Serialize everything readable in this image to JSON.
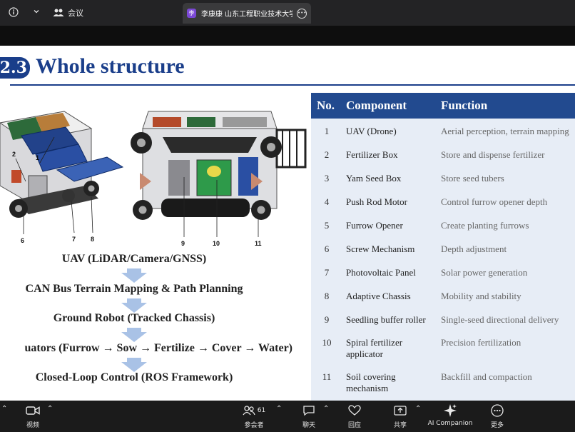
{
  "topbar": {
    "meeting_label": "会议",
    "tab_icon_letter": "李",
    "tab_title": "李康康 山东工程职业技术大学的..."
  },
  "slide": {
    "section_number": "2.3",
    "title": "Whole structure",
    "accent_color": "#1a3e8a",
    "figure_labels": [
      "1",
      "2",
      "6",
      "7",
      "8",
      "9",
      "10",
      "11"
    ],
    "flow": [
      "UAV (LiDAR/Camera/GNSS)",
      "CAN Bus Terrain Mapping & Path Planning",
      "Ground Robot (Tracked Chassis)",
      "uators (Furrow → Sow → Fertilize → Cover → Water)",
      "Closed-Loop Control (ROS Framework)"
    ],
    "table": {
      "headers": {
        "no": "No.",
        "component": "Component",
        "function": "Function"
      },
      "rows": [
        {
          "no": "1",
          "component": "UAV (Drone)",
          "function": "Aerial perception, terrain mapping"
        },
        {
          "no": "2",
          "component": "Fertilizer Box",
          "function": "Store and dispense fertilizer"
        },
        {
          "no": "3",
          "component": "Yam Seed Box",
          "function": "Store seed tubers"
        },
        {
          "no": "4",
          "component": "Push Rod Motor",
          "function": "Control furrow opener depth"
        },
        {
          "no": "5",
          "component": "Furrow Opener",
          "function": "Create planting furrows"
        },
        {
          "no": "6",
          "component": "Screw Mechanism",
          "function": "Depth adjustment"
        },
        {
          "no": "7",
          "component": "Photovoltaic Panel",
          "function": "Solar power generation"
        },
        {
          "no": "8",
          "component": "Adaptive Chassis",
          "function": "Mobility and stability"
        },
        {
          "no": "9",
          "component": "Seedling buffer roller",
          "function": "Single-seed directional delivery"
        },
        {
          "no": "10",
          "component": "Spiral fertilizer applicator",
          "function": "Precision fertilization"
        },
        {
          "no": "11",
          "component": "Soil covering mechanism",
          "function": "Backfill and compaction"
        }
      ]
    }
  },
  "toolbar": {
    "video_label": "视频",
    "participants_label": "参会者",
    "participants_count": "61",
    "chat_label": "聊天",
    "react_label": "回应",
    "share_label": "共享",
    "ai_label": "AI Companion",
    "more_label": "更多"
  }
}
